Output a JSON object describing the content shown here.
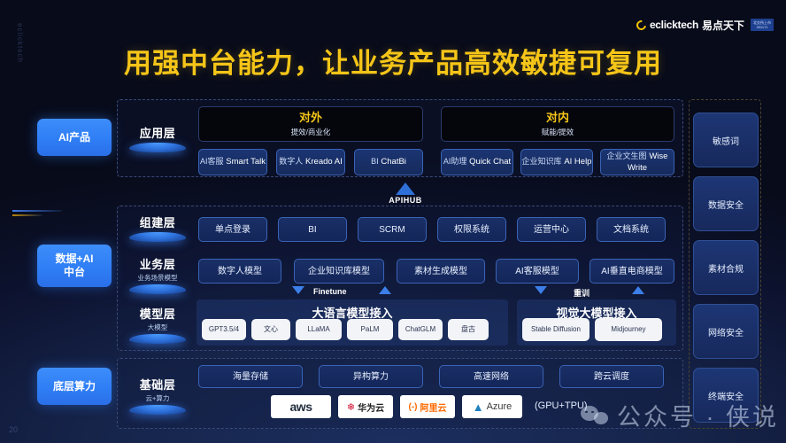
{
  "slide": {
    "page_number": "20",
    "side_vertical_text": "eclicktech",
    "title": "用强中台能力，让业务产品高效敏捷可复用",
    "accent_color": "#f5c518",
    "brand_blue": "#2f7ef5"
  },
  "logo": {
    "icon": "crescent-icon",
    "en": "eclicktech",
    "cn": "易点天下",
    "stock_code_line1": "北交所上市",
    "stock_code_line2": "301171"
  },
  "left_rail": [
    {
      "label": "AI产品"
    },
    {
      "label": "数据+AI\n中台"
    },
    {
      "label": "底层算力"
    }
  ],
  "application_layer": {
    "layer_main": "应用层",
    "layer_sub": "",
    "external": {
      "title": "对外",
      "subtitle": "提效/商业化",
      "cards": [
        {
          "cn": "AI客服",
          "en": "Smart Talk"
        },
        {
          "cn": "数字人",
          "en": "Kreado AI"
        },
        {
          "cn": "BI",
          "en": "ChatBi"
        }
      ]
    },
    "internal": {
      "title": "对内",
      "subtitle": "赋能/提效",
      "cards": [
        {
          "cn": "AI助理",
          "en": "Quick Chat"
        },
        {
          "cn": "企业知识库",
          "en": "AI Help"
        },
        {
          "cn": "企业文生图",
          "en": "Wise Write"
        }
      ]
    }
  },
  "apihub": {
    "label": "APIHUB",
    "icon": "arrow-up-icon"
  },
  "component_layer": {
    "layer_main": "组建层",
    "layer_sub": "",
    "cards": [
      "单点登录",
      "BI",
      "SCRM",
      "权限系统",
      "运营中心",
      "文档系统"
    ]
  },
  "business_layer": {
    "layer_main": "业务层",
    "layer_sub": "业务场景模型",
    "cards": [
      "数字人模型",
      "企业知识库模型",
      "素材生成模型",
      "AI客服模型",
      "AI垂直电商模型"
    ]
  },
  "flow_labels": {
    "finetune": "Finetune",
    "retrain": "重训"
  },
  "model_layer": {
    "layer_main": "模型层",
    "layer_sub": "大模型",
    "llm": {
      "title": "大语言模型接入",
      "items": [
        "GPT3.5/4",
        "文心",
        "LLaMA",
        "PaLM",
        "ChatGLM",
        "盘古"
      ]
    },
    "vision": {
      "title": "视觉大模型接入",
      "items": [
        "Stable Diffusion",
        "Midjourney"
      ]
    }
  },
  "infra_layer": {
    "layer_main": "基础层",
    "layer_sub": "云+算力",
    "cards": [
      "海量存储",
      "异构算力",
      "高速网络",
      "跨云调度"
    ],
    "vendors": [
      "aws",
      "华为云",
      "阿里云",
      "Azure"
    ],
    "note": "(GPU+TPU)"
  },
  "right_rail": [
    {
      "label": "敏感词"
    },
    {
      "label": "数据安全"
    },
    {
      "label": "素材合规"
    },
    {
      "label": "网络安全"
    },
    {
      "label": "终端安全"
    }
  ],
  "watermark": {
    "icon": "wechat-icon",
    "text": "公众号 · 侠说"
  }
}
